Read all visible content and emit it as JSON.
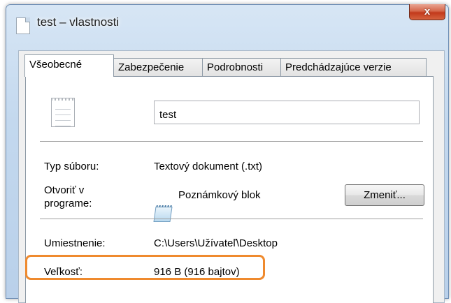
{
  "window": {
    "title": "test – vlastnosti",
    "close_label": "x"
  },
  "tabs": [
    {
      "label": "Všeobecné",
      "active": true
    },
    {
      "label": "Zabezpečenie",
      "active": false
    },
    {
      "label": "Podrobnosti",
      "active": false
    },
    {
      "label": "Predchádzajúce verzie",
      "active": false
    }
  ],
  "general": {
    "file_name": "test",
    "type_label": "Typ súboru:",
    "type_value": "Textový dokument (.txt)",
    "opens_with_label_line1": "Otvoriť v",
    "opens_with_label_line2": "programe:",
    "opens_with_value": "Poznámkový blok",
    "change_button": "Zmeniť...",
    "location_label": "Umiestnenie:",
    "location_value": "C:\\Users\\Užívateľ\\Desktop",
    "size_label": "Veľkosť:",
    "size_value": "916 B (916 bajtov)"
  },
  "icons": {
    "title_icon": "text-file-icon",
    "file_icon": "text-file-icon",
    "program_icon": "notepad-icon"
  },
  "colors": {
    "highlight": "#ef8a2e",
    "close_button": "#c2391b"
  }
}
